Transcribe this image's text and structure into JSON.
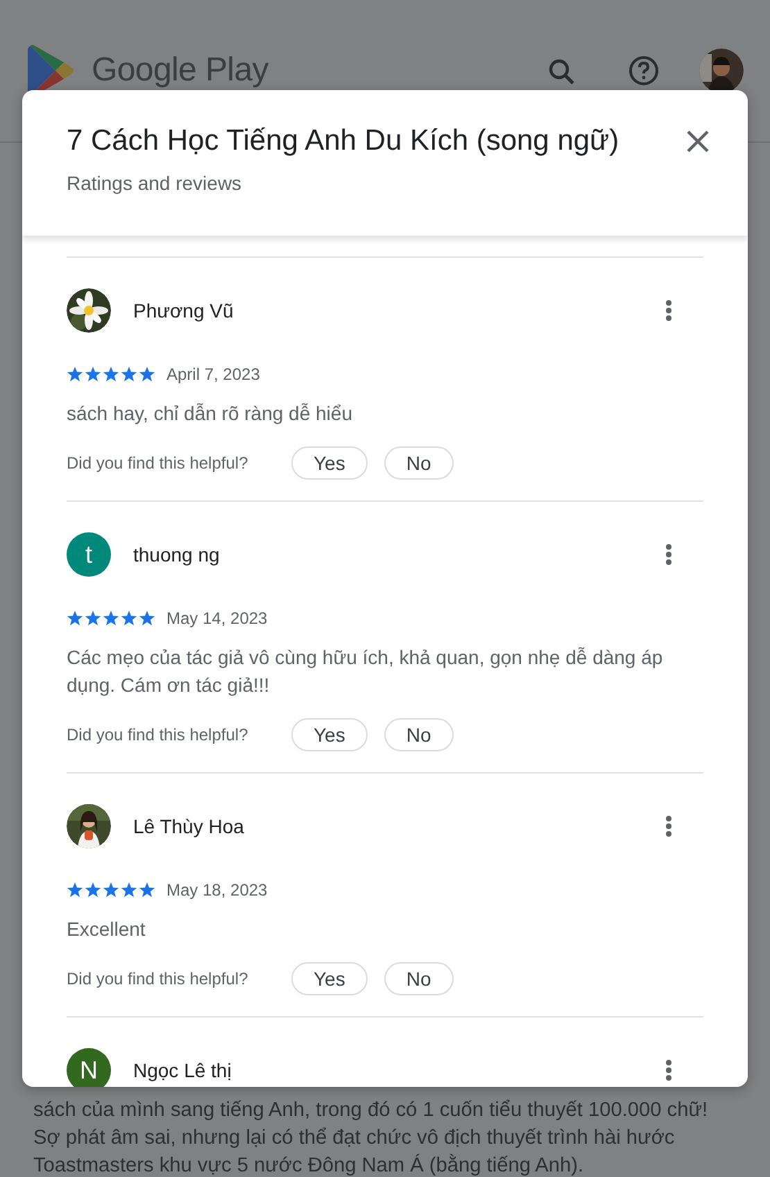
{
  "header": {
    "brand": "Google Play"
  },
  "background_text": {
    "lines": [
      "sách của mình sang tiếng Anh, trong đó có 1 cuốn tiểu thuyết 100.000 chữ!",
      "Sợ phát âm sai, nhưng lại có thể đạt chức vô địch thuyết trình hài hước",
      "Toastmasters khu vực 5 nước Đông Nam Á (bằng tiếng Anh)."
    ]
  },
  "dialog": {
    "title": "7 Cách Học Tiếng Anh Du Kích (song ngữ)",
    "subtitle": "Ratings and reviews",
    "reviews": [
      {
        "author": "Phương Vũ",
        "avatar": {
          "kind": "picture"
        },
        "stars": 5,
        "date": "April 7, 2023",
        "text": "sách hay, chỉ dẫn rõ ràng dễ hiểu",
        "helpful_prompt": "Did you find this helpful?",
        "buttons": [
          "Yes",
          "No"
        ]
      },
      {
        "author": "thuong ng",
        "avatar": {
          "kind": "letter",
          "letter": "t",
          "color": "#00897b"
        },
        "stars": 5,
        "date": "May 14, 2023",
        "text": "Các mẹo của tác giả vô cùng hữu ích, khả quan, gọn nhẹ dễ dàng áp dụng. Cám ơn tác giả!!!",
        "helpful_prompt": "Did you find this helpful?",
        "buttons": [
          "Yes",
          "No"
        ]
      },
      {
        "author": "Lê Thùy Hoa",
        "avatar": {
          "kind": "picture"
        },
        "stars": 5,
        "date": "May 18, 2023",
        "text": "Excellent",
        "helpful_prompt": "Did you find this helpful?",
        "buttons": [
          "Yes",
          "No"
        ]
      },
      {
        "author": "Ngọc Lê thị",
        "avatar": {
          "kind": "letter",
          "letter": "N",
          "color": "#33691e"
        }
      }
    ]
  }
}
